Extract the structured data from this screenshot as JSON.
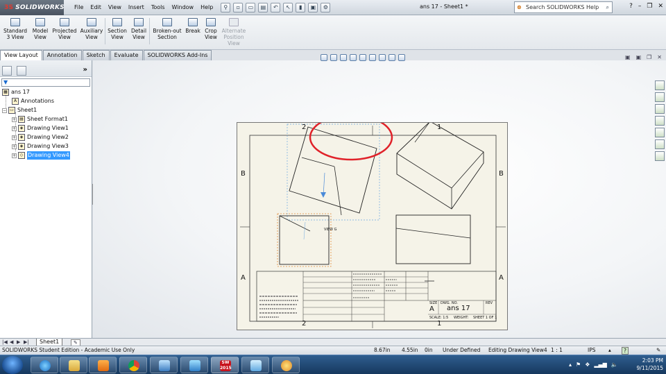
{
  "app": {
    "logo_text": "SOLIDWORKS",
    "document_title": "ans 17 - Sheet1 *",
    "search_placeholder": "Search SOLIDWORKS Help"
  },
  "menu": [
    "File",
    "Edit",
    "View",
    "Insert",
    "Tools",
    "Window",
    "Help"
  ],
  "commands": [
    {
      "label": "Standard\n3 View"
    },
    {
      "label": "Model\nView"
    },
    {
      "label": "Projected\nView"
    },
    {
      "label": "Auxiliary\nView"
    },
    {
      "label": "Section\nView"
    },
    {
      "label": "Detail\nView"
    },
    {
      "label": "Broken-out\nSection"
    },
    {
      "label": "Break"
    },
    {
      "label": "Crop\nView"
    },
    {
      "label": "Alternate\nPosition\nView",
      "disabled": true
    }
  ],
  "tabs": [
    "View Layout",
    "Annotation",
    "Sketch",
    "Evaluate",
    "SOLIDWORKS Add-Ins"
  ],
  "tree": {
    "root": "ans 17",
    "annotations": "Annotations",
    "sheet": "Sheet1",
    "children": [
      "Sheet Format1",
      "Drawing View1",
      "Drawing View2",
      "Drawing View3",
      "Drawing View4"
    ],
    "selected_index": 4
  },
  "sheet": {
    "zones_top": [
      "2",
      "1"
    ],
    "zones_bottom": [
      "2",
      "1"
    ],
    "zones_side": [
      "B",
      "A"
    ],
    "view_label": "VIEW G",
    "title_block": {
      "size": "A",
      "dwg_no": "ans 17",
      "size_label": "SIZE",
      "dwg_no_label": "DWG. NO.",
      "rev_label": "REV",
      "scale_text": "SCALE: 1:5",
      "weight_text": "WEIGHT:",
      "sheet_text": "SHEET 1 OF 1"
    }
  },
  "sheet_tab": "Sheet1",
  "status": {
    "edition": "SOLIDWORKS Student Edition - Academic Use Only",
    "x": "8.67in",
    "y": "4.55in",
    "z": "0in",
    "state": "Under Defined",
    "editing": "Editing Drawing View4",
    "scale": "1 : 1",
    "units": "IPS"
  },
  "taskbar": {
    "time": "2:03 PM",
    "date": "9/11/2015",
    "sw_badge": "2015"
  }
}
